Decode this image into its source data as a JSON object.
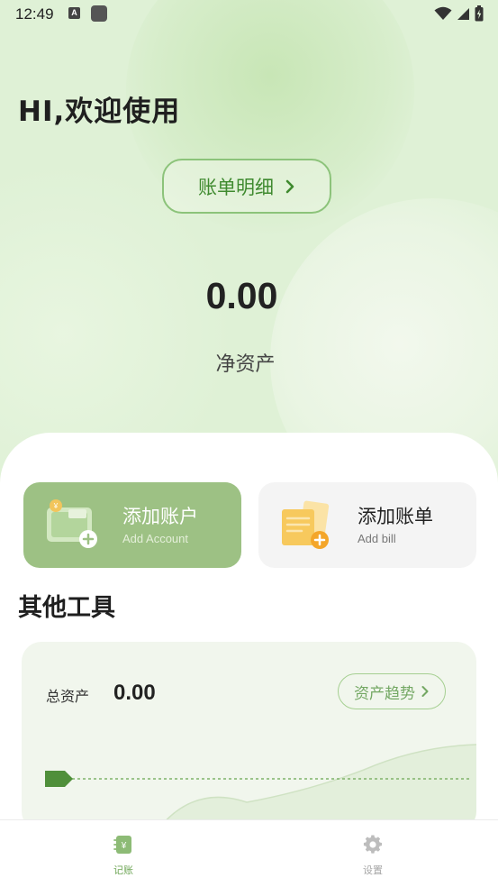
{
  "status_bar": {
    "time": "12:49",
    "notification_icon_letter": "A"
  },
  "header": {
    "greeting": "HI,欢迎使用",
    "bill_detail_button": "账单明细"
  },
  "net_assets": {
    "value": "0.00",
    "label": "净资产"
  },
  "actions": {
    "add_account": {
      "title": "添加账户",
      "subtitle": "Add Account"
    },
    "add_bill": {
      "title": "添加账单",
      "subtitle": "Add bill"
    }
  },
  "tools": {
    "section_title": "其他工具",
    "total_assets_label": "总资产",
    "total_assets_value": "0.00",
    "trend_button": "资产趋势"
  },
  "bottom_nav": {
    "items": [
      {
        "label": "记账",
        "icon": "bookkeeping-icon",
        "active": true
      },
      {
        "label": "设置",
        "icon": "gear-icon",
        "active": false
      }
    ]
  },
  "colors": {
    "accent_green": "#6ea656",
    "card_green": "#9dc184",
    "hero_background": "#dff1d6",
    "dark_green_marker": "#4f8f3a"
  }
}
